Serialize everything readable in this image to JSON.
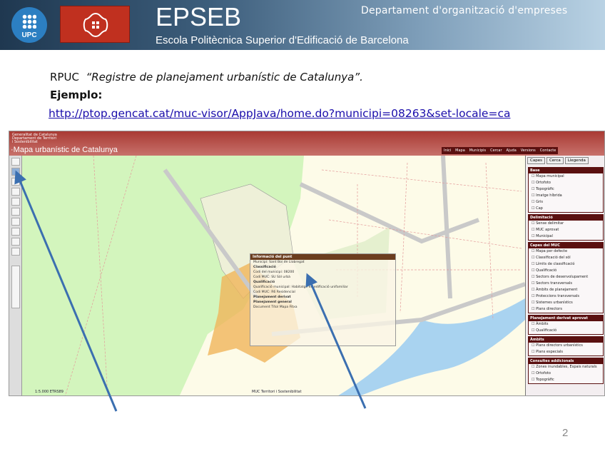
{
  "header": {
    "logo_upc": "UPC",
    "title": "EPSEB",
    "subtitle": "Escola Politècnica Superior d'Edificació de Barcelona",
    "department": "Departament d'organització d'empreses"
  },
  "body": {
    "line1_prefix": "RPUC",
    "line1_title": "“Registre de planejament urbanístic de Catalunya”.",
    "line2": "Ejemplo:",
    "link": "http://ptop.gencat.cat/muc-visor/AppJava/home.do?municipi=08263&set-locale=ca"
  },
  "screenshot": {
    "generalitat": [
      "Generalitat de Catalunya",
      "Departament de Territori",
      "i Sostenibilitat"
    ],
    "app_title": "·Mapa urbanístic de Catalunya",
    "menu": [
      "Inici",
      "Mapa",
      "Municipis",
      "Cercar",
      "Ajuda",
      "Versions",
      "Contacte"
    ],
    "tabs": [
      "Capes",
      "Cerca",
      "Llegenda"
    ],
    "sections": [
      {
        "title": "Base",
        "items": [
          "Mapa municipal",
          "Ortofoto",
          "Topogràfic",
          "Imatge híbrida",
          "Gris",
          "Cap"
        ]
      },
      {
        "title": "Delimitació",
        "items": [
          "Sense delimitar",
          "MUC aprovat",
          "Municipal"
        ]
      },
      {
        "title": "Capes del MUC",
        "items": [
          "Mapa per defecte",
          "Classificació del sòl",
          "Límits de classificació",
          "Qualificació",
          "Sectors de desenvolupament",
          "Sectors transversals",
          "Àmbits de planejament",
          "Proteccions transversals",
          "Sistemes urbanístics",
          "Plans directors"
        ]
      },
      {
        "title": "Planejament derivat aprovat",
        "items": [
          "Àmbits",
          "Qualificació"
        ]
      },
      {
        "title": "Àmbits",
        "items": [
          "Plans directors urbanístics",
          "Plans especials"
        ]
      },
      {
        "title": "Consultes addicionals",
        "items": [
          "Zones inundables, Espais naturals",
          "Ortofoto",
          "Topogràfic"
        ]
      }
    ],
    "popup": {
      "title": "Informació del punt",
      "rows": [
        "Municipi: Sant Boi de Llobregat",
        "Classificació",
        "Codi del municipi: 08200",
        "Codi MUC: SU  Sòl urbà",
        "Qualificació",
        "Qualificació municipal: Habitatge en edificació unifamiliar",
        "Codi MUC: R6  Residencial",
        "Planejament derivat",
        "Planejament general",
        "Document  Títol  Mapa  Fitxa"
      ]
    },
    "scale_text": "1:5.000  ETRS89",
    "credits": "MUC Territori i Sostenibilitat"
  },
  "page_number": "2",
  "colors": {
    "arrow": "#3b6fb0",
    "banner": "#a93a33",
    "panel_header": "#5a1010"
  }
}
